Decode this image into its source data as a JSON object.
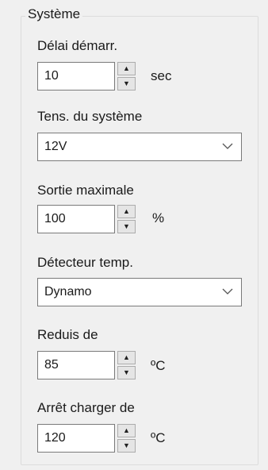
{
  "group": {
    "title": "Système"
  },
  "startup_delay": {
    "label": "Délai démarr.",
    "value": "10",
    "unit": "sec"
  },
  "system_voltage": {
    "label": "Tens. du système",
    "selected": "12V"
  },
  "max_output": {
    "label": "Sortie maximale",
    "value": "100",
    "unit": "%"
  },
  "temp_detector": {
    "label": "Détecteur temp.",
    "selected": "Dynamo"
  },
  "reduce_from": {
    "label": "Reduis de",
    "value": "85",
    "unit": "ºC"
  },
  "stop_charger": {
    "label": "Arrêt charger de",
    "value": "120",
    "unit": "ºC"
  },
  "icons": {
    "spin_up": "triangle-up-icon",
    "spin_down": "triangle-down-icon",
    "dropdown": "chevron-down-icon"
  }
}
